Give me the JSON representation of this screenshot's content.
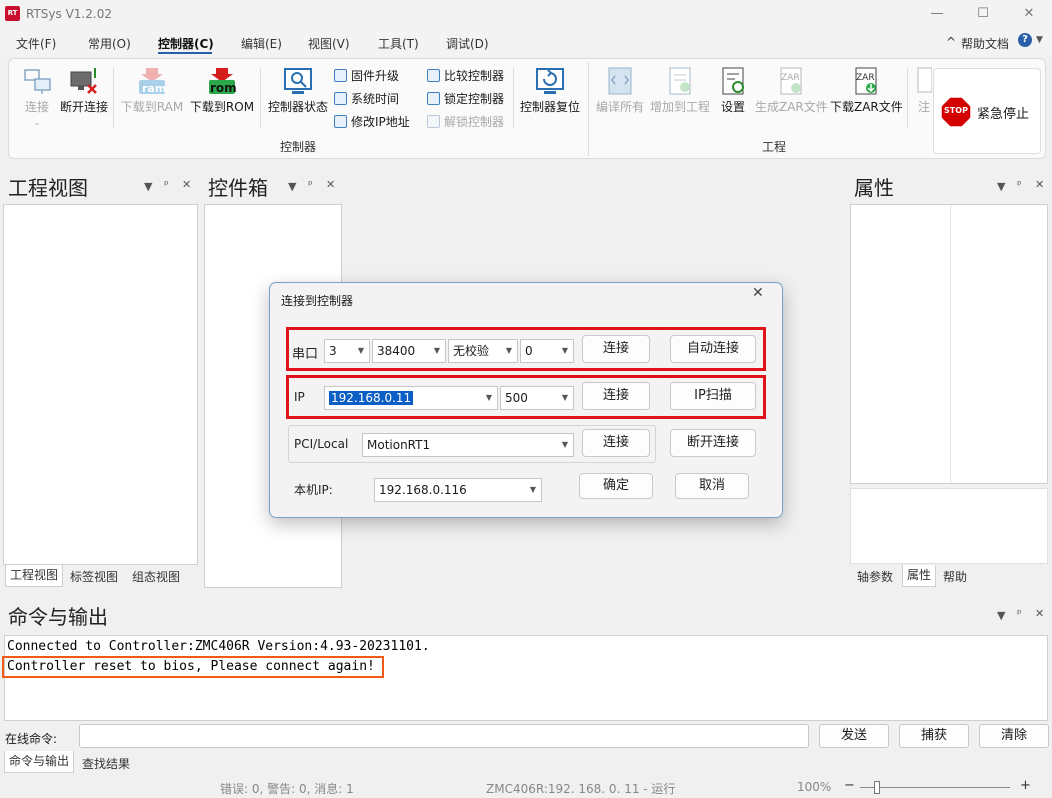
{
  "app": {
    "title": "RTSys V1.2.02",
    "logo_text": "RT"
  },
  "window": {
    "minimize": "—",
    "maximize": "☐",
    "close": "✕"
  },
  "menu": {
    "items": [
      "文件(F)",
      "常用(O)",
      "控制器(C)",
      "编辑(E)",
      "视图(V)",
      "工具(T)",
      "调试(D)"
    ],
    "help": "帮助文档",
    "collapse": "^"
  },
  "ribbon": {
    "connect": "连接",
    "disconnect": "断开连接",
    "download_ram": "下载到RAM",
    "download_rom": "下载到ROM",
    "ram_icon": "ram",
    "rom_icon": "rom",
    "controller_status": "控制器状态",
    "firmware_upgrade": "固件升级",
    "system_time": "系统时间",
    "modify_ip": "修改IP地址",
    "compare_controller": "比较控制器",
    "lock_controller": "锁定控制器",
    "unlock_controller": "解锁控制器",
    "controller_reset": "控制器复位",
    "group_controller": "控制器",
    "compile_all": "编译所有",
    "add_to_project": "增加到工程",
    "settings": "设置",
    "generate_zar": "生成ZAR文件",
    "download_zar": "下载ZAR文件",
    "zar_icon": "ZAR",
    "group_project": "工程",
    "note_partial": "注",
    "estop_icon": "STOP",
    "estop": "紧急停止"
  },
  "panels": {
    "project_view": "工程视图",
    "toolbox": "控件箱",
    "properties": "属性",
    "output": "命令与输出",
    "ctrl_menu": "▼",
    "ctrl_pin": "ᵖ",
    "ctrl_close": "✕"
  },
  "left_tabs": [
    "工程视图",
    "标签视图",
    "组态视图"
  ],
  "right_tabs": [
    "轴参数",
    "属性",
    "帮助"
  ],
  "bottom_tabs": [
    "命令与输出",
    "查找结果"
  ],
  "dialog": {
    "title": "连接到控制器",
    "close": "✕",
    "serial_label": "串口",
    "serial_port": "3",
    "baud_rate": "38400",
    "parity": "无校验",
    "serial_extra": "0",
    "connect": "连接",
    "auto_connect": "自动连接",
    "ip_label": "IP",
    "ip_value": "192.168.0.11",
    "ip_port": "500",
    "ip_scan": "IP扫描",
    "pci_label": "PCI/Local",
    "pci_value": "MotionRT1",
    "disconnect": "断开连接",
    "local_ip_label": "本机IP:",
    "local_ip_value": "192.168.0.116",
    "ok": "确定",
    "cancel": "取消"
  },
  "output": {
    "lines": [
      "Connected to Controller:ZMC406R Version:4.93-20231101.",
      "Controller reset to bios, Please connect again!"
    ],
    "command_label": "在线命令:",
    "send": "发送",
    "capture": "捕获",
    "clear": "清除"
  },
  "status": {
    "messages": "错误: 0, 警告: 0, 消息: 1",
    "connection": "ZMC406R:192. 168. 0. 11 - 运行",
    "zoom": "100%",
    "zoom_minus": "−",
    "zoom_plus": "+"
  },
  "colors": {
    "accent": "#2a5fa8",
    "highlight_red": "#e0121b",
    "highlight_orange": "#f05a14",
    "estop_red": "#d40000"
  }
}
